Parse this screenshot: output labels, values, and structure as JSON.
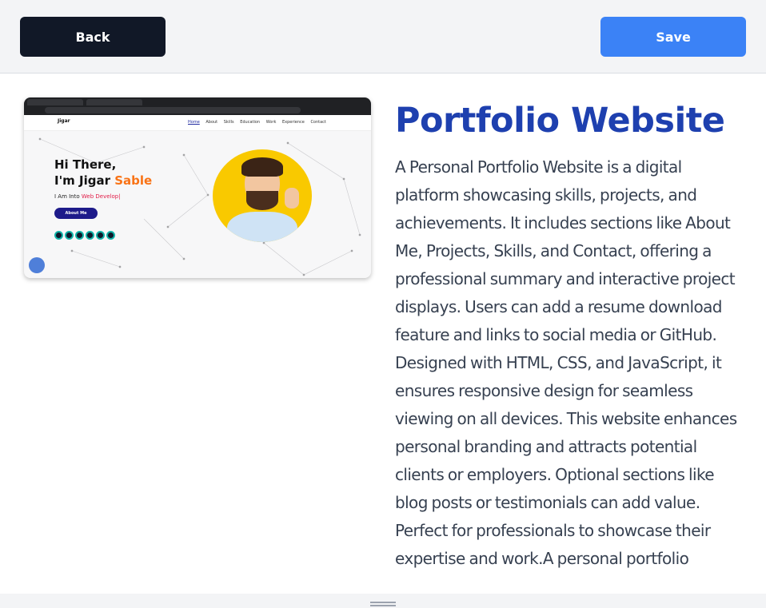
{
  "toolbar": {
    "back_label": "Back",
    "save_label": "Save",
    "back_color": "#111827",
    "save_color": "#3b82f6"
  },
  "project": {
    "title": "Portfolio Website",
    "title_color": "#1e40af",
    "description": "A Personal Portfolio Website is a digital platform showcasing skills, projects, and achievements. It includes sections like About Me, Projects, Skills, and Contact, offering a professional summary and interactive project displays. Users can add a resume download feature and links to social media or GitHub. Designed with HTML, CSS, and JavaScript, it ensures responsive design for seamless viewing on all devices. This website enhances personal branding and attracts potential clients or employers. Optional sections like blog posts or testimonials can add value. Perfect for professionals to showcase their expertise and work.A personal portfolio",
    "preview": {
      "logo": "Jigar",
      "nav": [
        "Home",
        "About",
        "Skills",
        "Education",
        "Work",
        "Experience",
        "Contact"
      ],
      "greeting_line1": "Hi There,",
      "greeting_line2": "I'm Jigar",
      "greeting_name": "Sable",
      "tagline_prefix": "I Am Into",
      "tagline_highlight": "Web Develop|",
      "about_button": "About Me",
      "accent": "#f97316"
    }
  },
  "resize_handle_icon": "drag-handle-icon"
}
